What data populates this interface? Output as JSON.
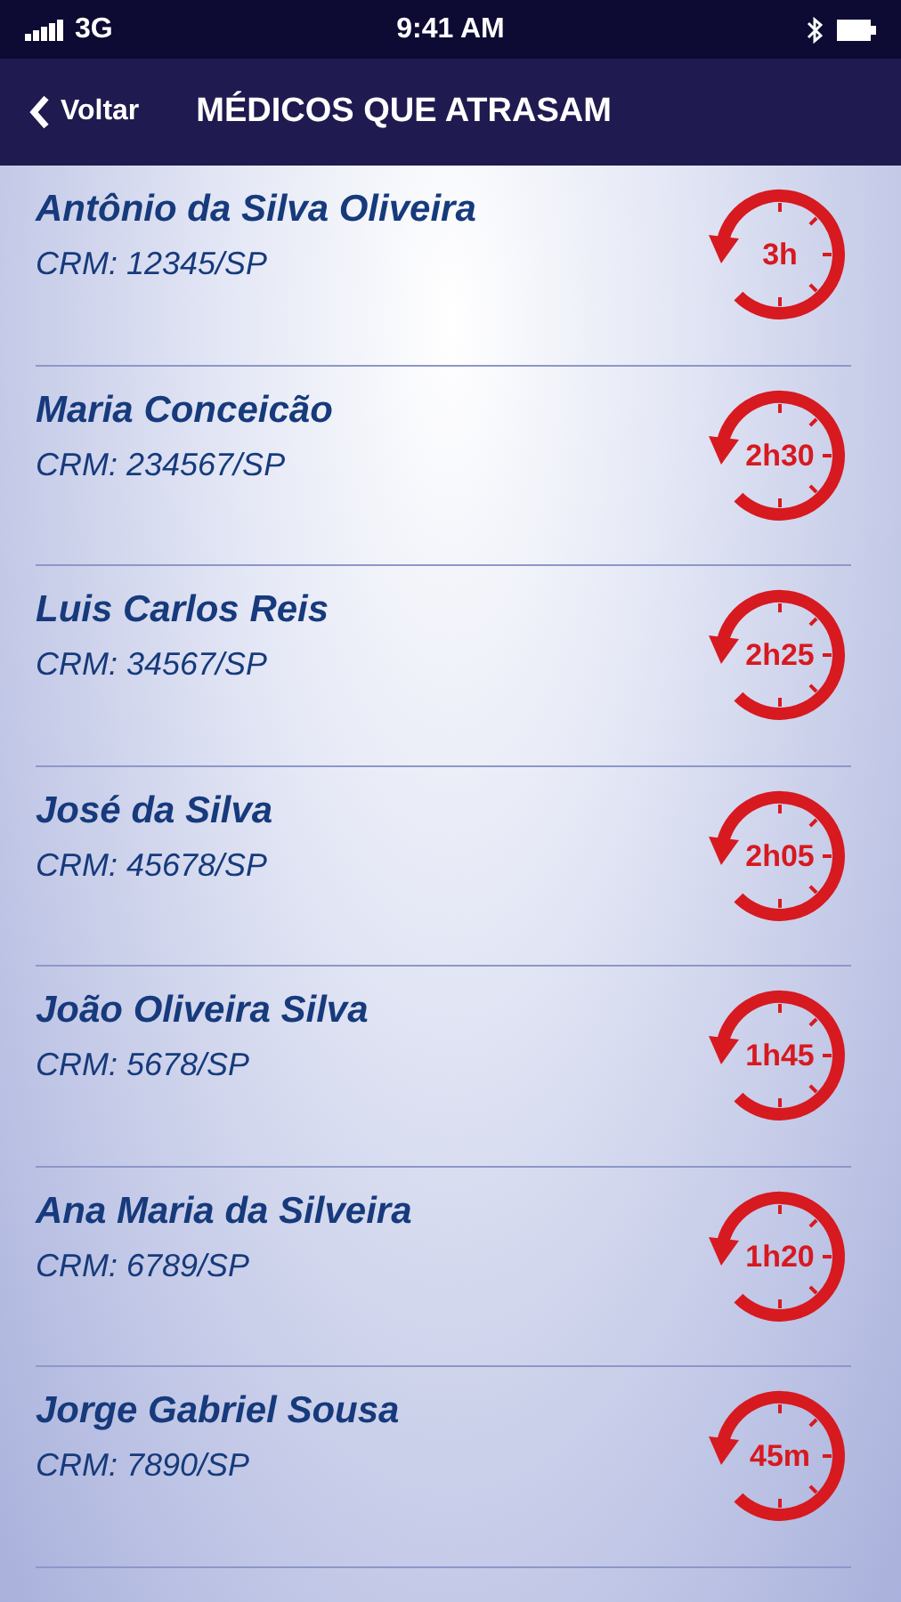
{
  "status_bar": {
    "carrier": "3G",
    "time": "9:41 AM"
  },
  "nav_bar": {
    "back": "Voltar",
    "title": "MÉDICOS QUE ATRASAM"
  },
  "doctors": [
    {
      "name": "Antônio da Silva Oliveira",
      "crm": "CRM: 12345/SP",
      "delay": "3h"
    },
    {
      "name": "Maria Conceicão",
      "crm": "CRM: 234567/SP",
      "delay": "2h30"
    },
    {
      "name": "Luis Carlos Reis",
      "crm": "CRM: 34567/SP",
      "delay": "2h25"
    },
    {
      "name": "José da Silva",
      "crm": "CRM: 45678/SP",
      "delay": "2h05"
    },
    {
      "name": "João Oliveira Silva",
      "crm": "CRM: 5678/SP",
      "delay": "1h45"
    },
    {
      "name": "Ana Maria da Silveira",
      "crm": "CRM: 6789/SP",
      "delay": "1h20"
    },
    {
      "name": "Jorge Gabriel Sousa",
      "crm": "CRM: 7890/SP",
      "delay": "45m"
    }
  ]
}
